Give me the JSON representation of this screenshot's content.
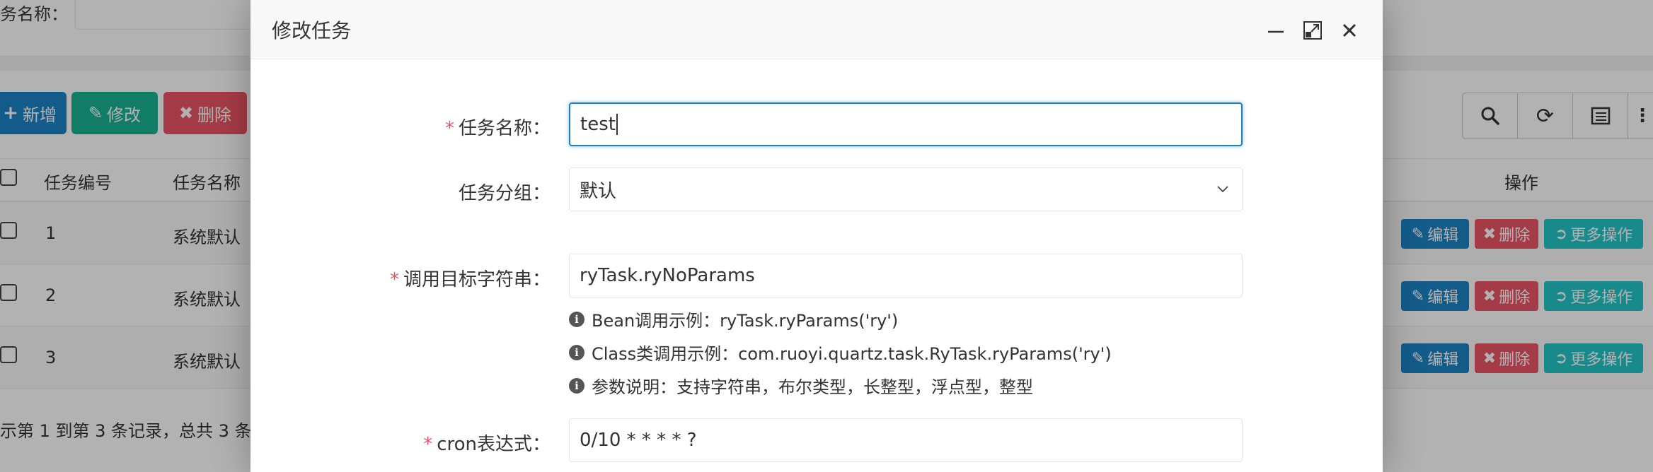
{
  "background": {
    "search_label": "务名称：",
    "toolbar": {
      "add_label": "新增",
      "edit_label": "修改",
      "delete_label": "删除"
    },
    "table": {
      "headers": {
        "id": "任务编号",
        "name": "任务名称",
        "actions": "操作"
      },
      "rows": [
        {
          "id": "1",
          "name": "系统默认"
        },
        {
          "id": "2",
          "name": "系统默认"
        },
        {
          "id": "3",
          "name": "系统默认"
        }
      ],
      "row_actions": {
        "edit": "编辑",
        "delete": "删除",
        "more": "更多操作"
      }
    },
    "pagination_text": "示第 1 到第 3 条记录，总共 3 条"
  },
  "modal": {
    "title": "修改任务",
    "fields": {
      "job_name": {
        "label": "任务名称：",
        "value": "test",
        "required": true
      },
      "job_group": {
        "label": "任务分组：",
        "value": "默认",
        "required": false
      },
      "invoke_target": {
        "label": "调用目标字符串：",
        "value": "ryTask.ryNoParams",
        "required": true
      },
      "cron": {
        "label": "cron表达式：",
        "value": "0/10 * * * * ?",
        "required": true
      }
    },
    "help_lines": [
      "Bean调用示例：ryTask.ryParams('ry')",
      "Class类调用示例：com.ruoyi.quartz.task.RyTask.ryParams('ry')",
      "参数说明：支持字符串，布尔类型，长整型，浮点型，整型"
    ],
    "required_mark": "*"
  },
  "colors": {
    "primary": "#1c84c6",
    "success": "#1ab394",
    "danger": "#ed5565",
    "info": "#23c6c8"
  }
}
